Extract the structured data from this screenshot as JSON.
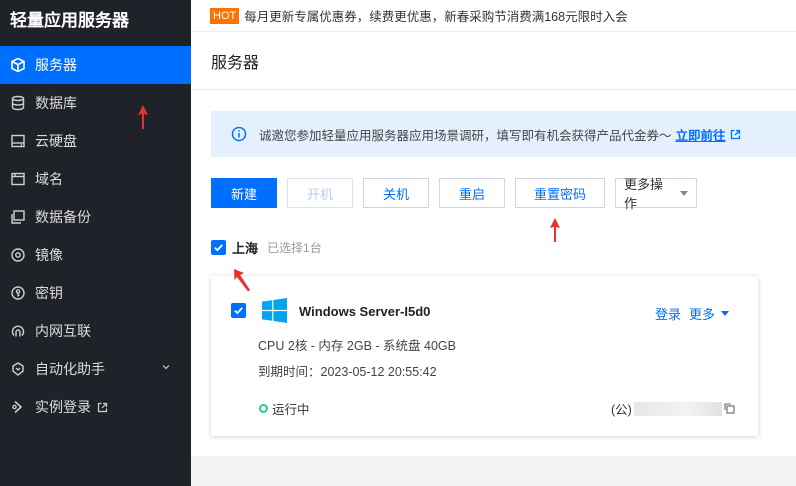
{
  "sidebar": {
    "brand": "轻量应用服务器",
    "items": [
      {
        "label": "服务器",
        "icon": "cube-icon",
        "active": true
      },
      {
        "label": "数据库",
        "icon": "database-icon"
      },
      {
        "label": "云硬盘",
        "icon": "disk-icon"
      },
      {
        "label": "域名",
        "icon": "domain-icon"
      },
      {
        "label": "数据备份",
        "icon": "backup-icon"
      },
      {
        "label": "镜像",
        "icon": "image-icon"
      },
      {
        "label": "密钥",
        "icon": "key-icon"
      },
      {
        "label": "内网互联",
        "icon": "network-icon"
      },
      {
        "label": "自动化助手",
        "icon": "automation-icon"
      },
      {
        "label": "实例登录",
        "icon": "login-icon"
      }
    ]
  },
  "notice": {
    "tag": "HOT",
    "text": "每月更新专属优惠券，续费更优惠，新春采购节消费满168元限时入会"
  },
  "header": {
    "title": "服务器"
  },
  "banner": {
    "text": "诚邀您参加轻量应用服务器应用场景调研，填写即有机会获得产品代金券～",
    "link": "立即前往"
  },
  "toolbar": {
    "create": "新建",
    "start": "开机",
    "shutdown": "关机",
    "restart": "重启",
    "reset_password": "重置密码",
    "more_actions": "更多操作"
  },
  "region": {
    "name": "上海",
    "selected": "已选择1台"
  },
  "server": {
    "name": "Windows Server-I5d0",
    "login": "登录",
    "more": "更多",
    "spec": "CPU 2核 - 内存 2GB - 系统盘 40GB",
    "expiry": "到期时间：2023-05-12 20:55:42",
    "status": "运行中",
    "ip_prefix": "(公)"
  },
  "colors": {
    "primary": "#006eff",
    "sidebar_bg": "#1f2329",
    "hot": "#ff7200",
    "running": "#29cc85",
    "annotation_arrow": "#e8302f"
  }
}
